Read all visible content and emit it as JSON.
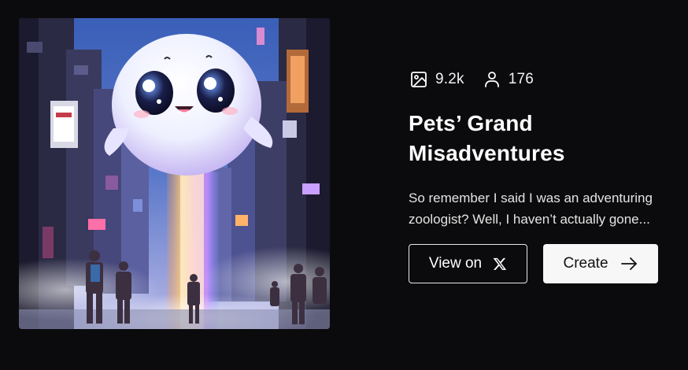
{
  "stats": {
    "images_count": "9.2k",
    "images_icon": "image-icon",
    "users_count": "176",
    "users_icon": "user-icon"
  },
  "title": "Pets’ Grand Misadventures",
  "description": "So remember I said I was an adventuring zoologist? Well, I haven’t actually gone...",
  "actions": {
    "view_label": "View on",
    "view_icon": "x-logo-icon",
    "create_label": "Create",
    "create_icon": "arrow-right-icon"
  },
  "colors": {
    "background": "#0b0b0d",
    "text": "#ffffff",
    "button_light": "#f7f7f7",
    "button_outline": "#e8e8e8"
  }
}
